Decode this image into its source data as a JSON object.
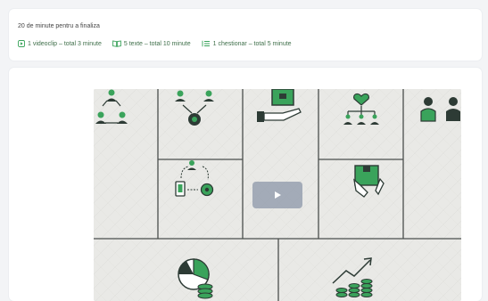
{
  "lesson": {
    "duration_text": "20 de minute pentru a finaliza",
    "items": [
      {
        "icon": "play-video-icon",
        "label": "1 videoclip – total 3 minute"
      },
      {
        "icon": "open-book-icon",
        "label": "5 texte – total 10 minute"
      },
      {
        "icon": "checklist-icon",
        "label": "1 chestionar – total 5 minute"
      }
    ]
  },
  "video": {
    "play_icon": "play-icon"
  },
  "colors": {
    "accent_green": "#3aa35b",
    "icon_dark": "#2d3b35",
    "link_text": "#3f6f4a"
  }
}
